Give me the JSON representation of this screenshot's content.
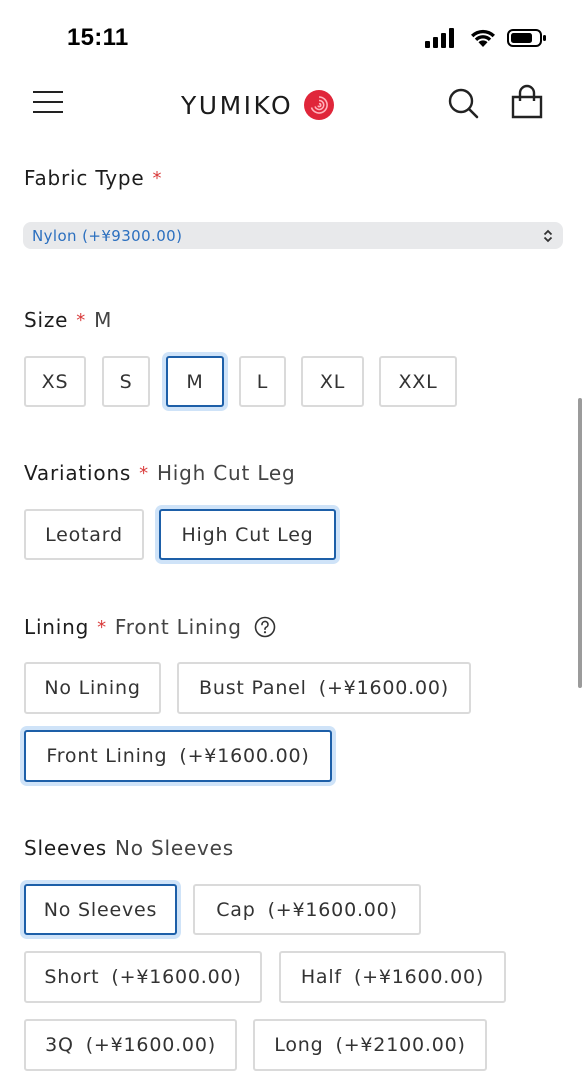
{
  "status": {
    "time": "15:11"
  },
  "header": {
    "brand": "YUMIKO"
  },
  "fabric": {
    "label": "Fabric Type",
    "required_mark": "*",
    "selected_value": "Nylon (+¥9300.00)"
  },
  "size": {
    "label": "Size",
    "required_mark": "*",
    "current": "M",
    "options": [
      "XS",
      "S",
      "M",
      "L",
      "XL",
      "XXL"
    ]
  },
  "variations": {
    "label": "Variations",
    "required_mark": "*",
    "current": "High Cut Leg",
    "options": [
      "Leotard",
      "High Cut Leg"
    ]
  },
  "lining": {
    "label": "Lining",
    "required_mark": "*",
    "current": "Front Lining",
    "options": [
      {
        "name": "No Lining",
        "price": ""
      },
      {
        "name": "Bust Panel",
        "price": "(+¥1600.00)"
      },
      {
        "name": "Front Lining",
        "price": "(+¥1600.00)"
      }
    ]
  },
  "sleeves": {
    "label": "Sleeves",
    "current": "No Sleeves",
    "options": [
      {
        "name": "No Sleeves",
        "price": ""
      },
      {
        "name": "Cap",
        "price": "(+¥1600.00)"
      },
      {
        "name": "Short",
        "price": "(+¥1600.00)"
      },
      {
        "name": "Half",
        "price": "(+¥1600.00)"
      },
      {
        "name": "3Q",
        "price": "(+¥1600.00)"
      },
      {
        "name": "Long",
        "price": "(+¥2100.00)"
      }
    ]
  },
  "colors": {
    "accent": "#1d5fa8",
    "accent_glow": "#cfe3f8",
    "required": "#d93a3a",
    "select_text": "#2b6fbf",
    "logo_mark": "#e0263a"
  },
  "icons": [
    "signal-icon",
    "wifi-icon",
    "battery-icon",
    "menu-icon",
    "logo-mark-icon",
    "search-icon",
    "shopping-bag-icon",
    "help-icon",
    "select-arrows-icon"
  ]
}
